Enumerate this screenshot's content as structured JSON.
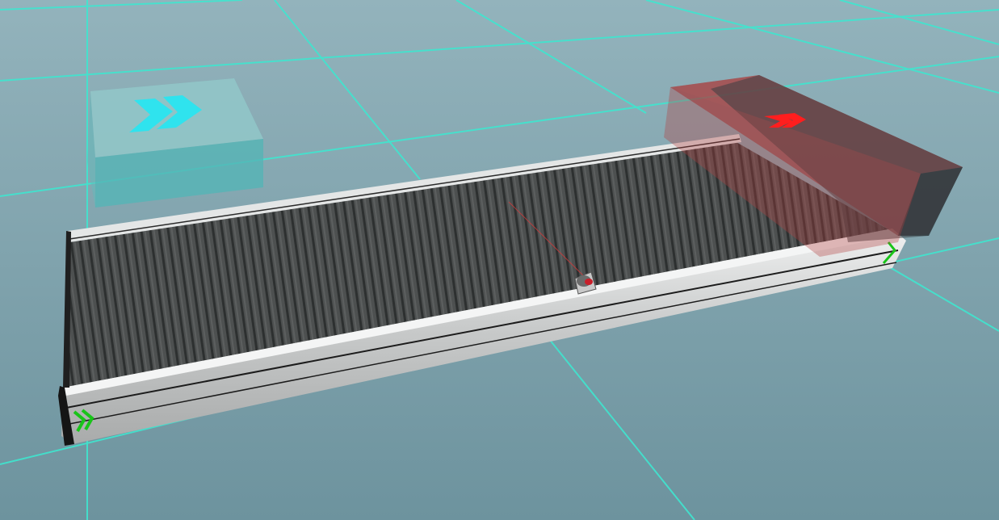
{
  "scene": {
    "colors": {
      "floor_top": "#8fb0b9",
      "floor_bottom": "#6f95a0",
      "grid_line": "#3fe6cf",
      "belt_surface": "#4a4d4d",
      "belt_ridge": "#2f3232",
      "frame_light": "#e2e4e4",
      "frame_shadow": "#9a9c9c",
      "source_box": "#73c7c6",
      "source_arrow": "#2fe3ee",
      "sink_box": "#8a2a2a",
      "sink_arrow": "#ff1e1e",
      "direction_marker": "#19c419",
      "sensor_beam": "#d23a3a"
    },
    "icons": {
      "source_arrow": "double-chevron-right-icon",
      "sink_arrow": "double-chevron-right-icon",
      "belt_start_marker": "double-chevron-right-icon",
      "belt_end_marker": "chevron-icon"
    }
  }
}
